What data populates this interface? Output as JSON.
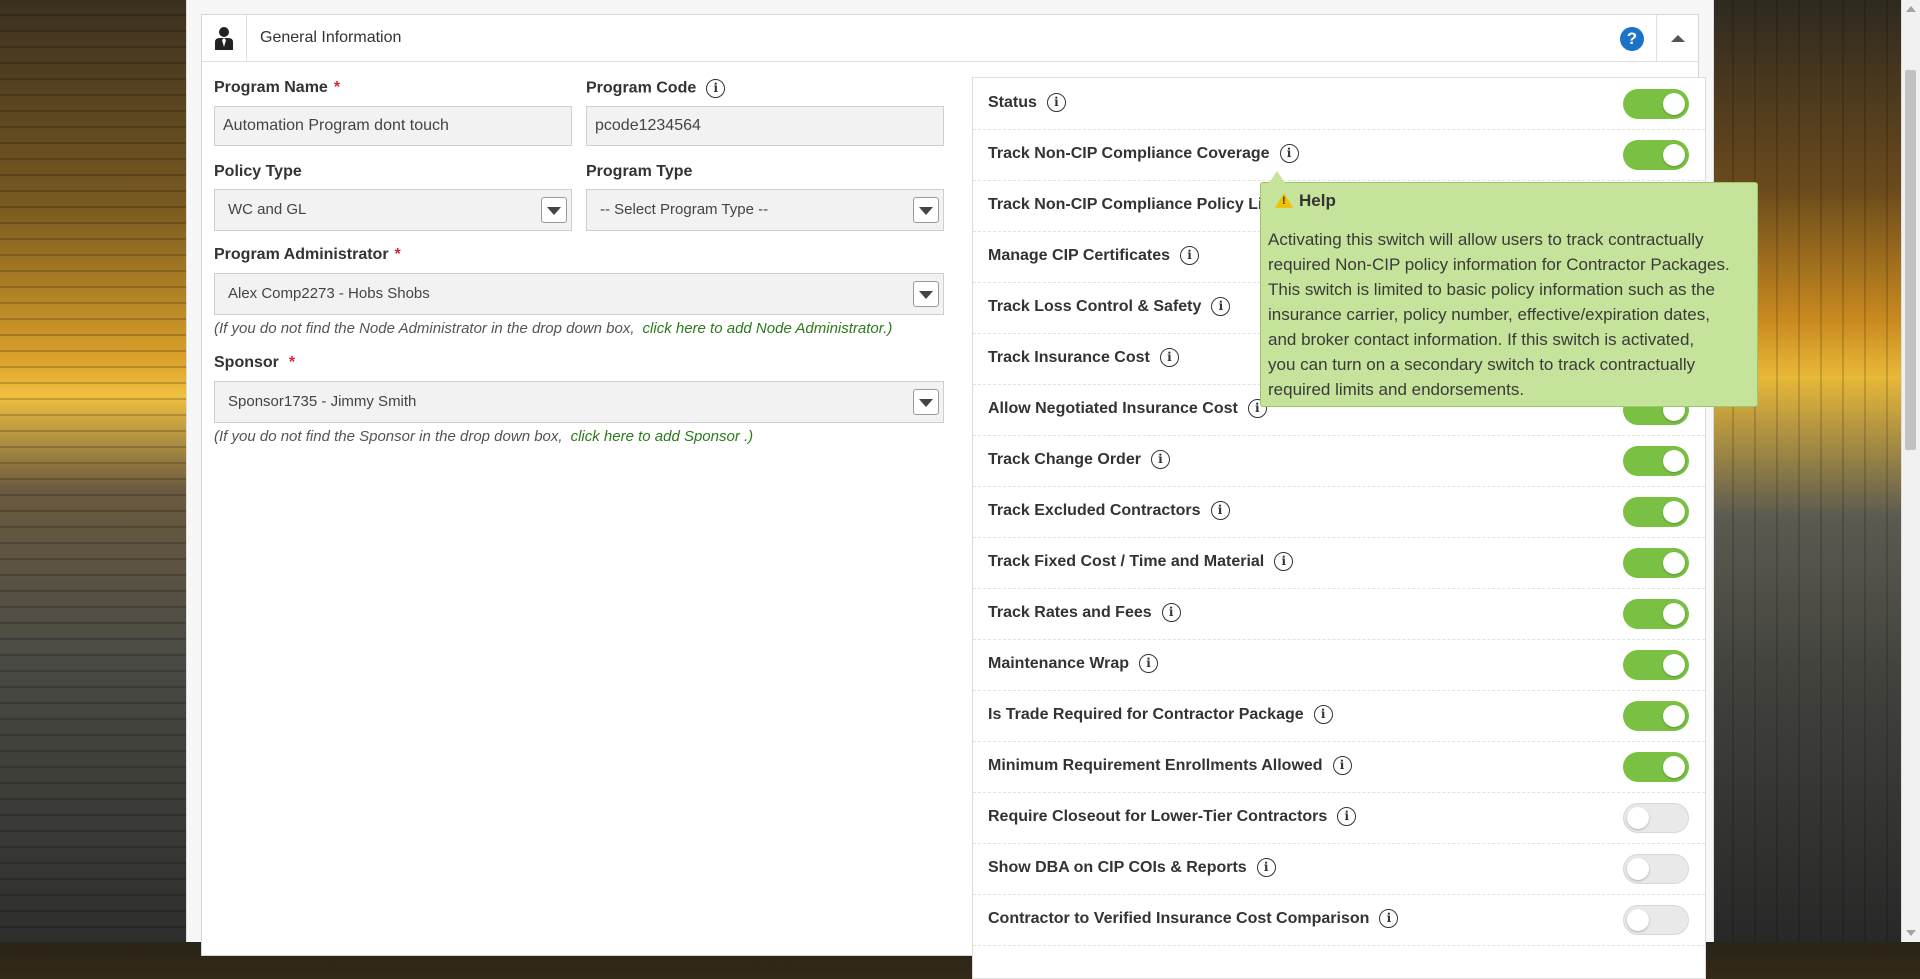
{
  "panel": {
    "title": "General Information",
    "help_label": "?"
  },
  "form": {
    "program_name": {
      "label": "Program Name",
      "required": "*",
      "value": "Automation Program dont touch"
    },
    "program_code": {
      "label": "Program Code",
      "value": "pcode1234564"
    },
    "policy_type": {
      "label": "Policy Type",
      "value": "WC and GL"
    },
    "program_type": {
      "label": "Program Type",
      "value": "-- Select Program Type --"
    },
    "program_administrator": {
      "label": "Program Administrator",
      "required": "*",
      "value": "Alex Comp2273 - Hobs Shobs"
    },
    "admin_hint": {
      "text": "(If you do not find the Node Administrator in the drop down box,",
      "link": "click here to add Node Administrator.)"
    },
    "sponsor": {
      "label": "Sponsor",
      "required": "*",
      "value": "Sponsor1735 - Jimmy Smith"
    },
    "sponsor_hint": {
      "text": "(If you do not find the Sponsor in the drop down box,",
      "link": "click here to add Sponsor .)"
    }
  },
  "settings": [
    {
      "label": "Status",
      "on": true
    },
    {
      "label": "Track Non-CIP Compliance Coverage",
      "on": true
    },
    {
      "label": "Track Non-CIP Compliance Policy Limits",
      "on": true
    },
    {
      "label": "Manage CIP Certificates",
      "on": true
    },
    {
      "label": "Track Loss Control & Safety",
      "on": true
    },
    {
      "label": "Track Insurance Cost",
      "on": true
    },
    {
      "label": "Allow Negotiated Insurance Cost",
      "on": true
    },
    {
      "label": "Track Change Order",
      "on": true
    },
    {
      "label": "Track Excluded Contractors",
      "on": true
    },
    {
      "label": "Track Fixed Cost / Time and Material",
      "on": true
    },
    {
      "label": "Track Rates and Fees",
      "on": true
    },
    {
      "label": "Maintenance Wrap",
      "on": true
    },
    {
      "label": "Is Trade Required for Contractor Package",
      "on": true
    },
    {
      "label": "Minimum Requirement Enrollments Allowed",
      "on": true
    },
    {
      "label": "Require Closeout for Lower-Tier Contractors",
      "on": false
    },
    {
      "label": "Show DBA on CIP COIs & Reports",
      "on": false
    },
    {
      "label": "Contractor to Verified Insurance Cost Comparison",
      "on": false
    }
  ],
  "tooltip": {
    "title": "Help",
    "lines": [
      "Activating this switch will allow users to track contractually",
      "required Non-CIP policy information for Contractor Packages.",
      "This switch is limited to basic policy information such as the",
      "insurance carrier, policy number, effective/expiration dates,",
      "and broker contact information. If this switch is activated,",
      "you can turn on a secondary switch to track contractually",
      "required limits and endorsements."
    ]
  },
  "colors": {
    "toggle_on": "#7ac143",
    "link": "#2b7a1b",
    "required": "#d9262c",
    "help_icon": "#1a73c8",
    "tooltip_bg": "#c5e39a"
  }
}
